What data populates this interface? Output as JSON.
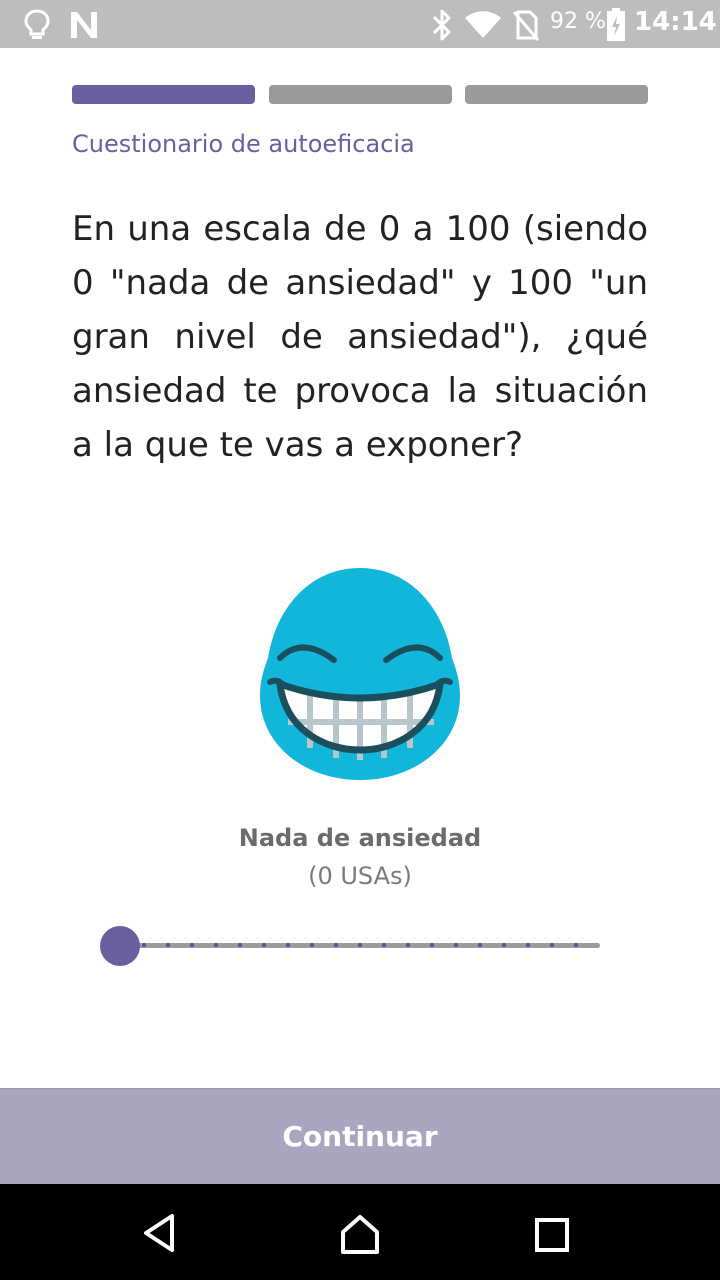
{
  "status_bar": {
    "battery": "92 %",
    "time": "14:14",
    "icons": [
      "lightbulb-icon",
      "n-logo-icon",
      "bluetooth-icon",
      "wifi-icon",
      "no-sim-icon",
      "battery-icon"
    ]
  },
  "progress": {
    "total_steps": 3,
    "current_step": 1,
    "active_color": "#6a5f9f",
    "inactive_color": "#9a9a9a"
  },
  "questionnaire": {
    "title": "Cuestionario de autoeficacia",
    "question": "En una escala de 0 a 100 (siendo 0 \"nada de ansiedad\" y 100 \"un gran nivel de ansiedad\"), ¿qué ansiedad te provoca la situación a la que te vas a exponer?"
  },
  "feedback": {
    "emoji": "laughing-face-icon",
    "level_label": "Nada de ansiedad",
    "units_label": "(0 USAs)"
  },
  "slider": {
    "value": 0,
    "min": 0,
    "max": 100,
    "step": 5
  },
  "actions": {
    "continue_label": "Continuar"
  },
  "nav": {
    "icons": [
      "back-icon",
      "home-icon",
      "recents-icon"
    ]
  }
}
